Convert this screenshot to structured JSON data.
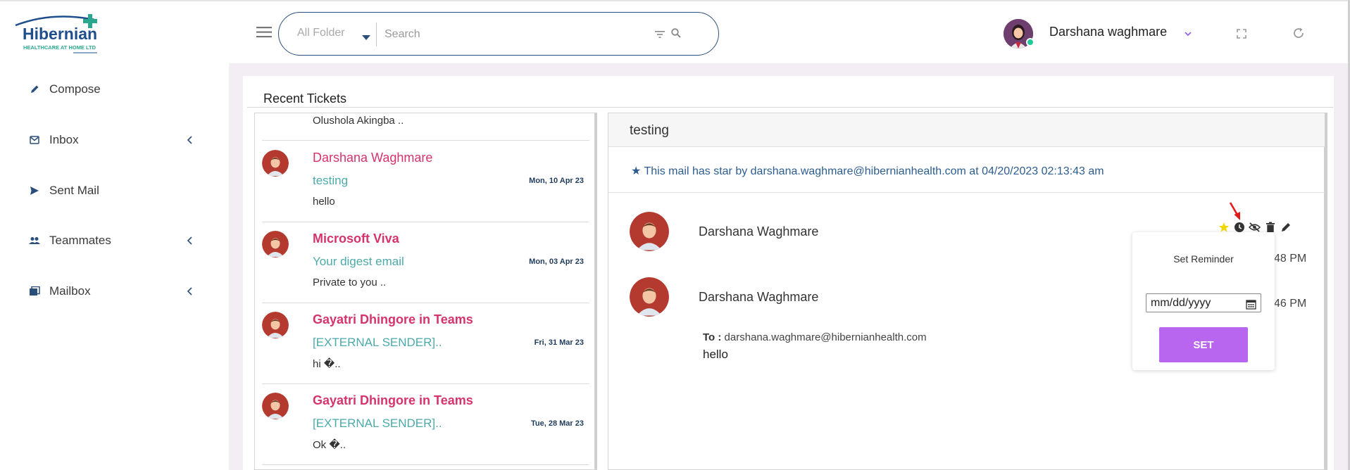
{
  "brand": {
    "name": "Hibernian",
    "tagline": "HEALTHCARE AT HOME LTD"
  },
  "sidebar": {
    "items": [
      {
        "label": "Compose",
        "icon": "pencil-icon",
        "has_submenu": false
      },
      {
        "label": "Inbox",
        "icon": "mail-icon",
        "has_submenu": true
      },
      {
        "label": "Sent Mail",
        "icon": "send-icon",
        "has_submenu": false
      },
      {
        "label": "Teammates",
        "icon": "people-icon",
        "has_submenu": true
      },
      {
        "label": "Mailbox",
        "icon": "folders-icon",
        "has_submenu": true
      }
    ]
  },
  "header": {
    "folder_selected": "All Folder",
    "search_placeholder": "Search",
    "user_name": "Darshana waghmare"
  },
  "recent_tickets": {
    "title": "Recent Tickets",
    "top_partial_preview": "Olushola Akingba ..",
    "tickets": [
      {
        "sender": "Darshana Waghmare",
        "subject": "testing",
        "date": "Mon, 10 Apr 23",
        "preview": "hello",
        "bold": false
      },
      {
        "sender": "Microsoft Viva",
        "subject": "Your digest email",
        "date": "Mon, 03 Apr 23",
        "preview": "Private to you ..",
        "bold": true
      },
      {
        "sender": "Gayatri Dhingore in Teams",
        "subject": "[EXTERNAL SENDER]..",
        "date": "Fri, 31 Mar 23",
        "preview": "hi     �..",
        "bold": true
      },
      {
        "sender": "Gayatri Dhingore in Teams",
        "subject": "[EXTERNAL SENDER]..",
        "date": "Tue, 28 Mar 23",
        "preview": "Ok     �..",
        "bold": true
      }
    ]
  },
  "message_view": {
    "subject": "testing",
    "star_note": "★ This mail has star by darshana.waghmare@hibernianhealth.com at 04/20/2023 02:13:43 am",
    "messages": [
      {
        "sender": "Darshana Waghmare",
        "time_partial": "48 PM"
      },
      {
        "sender": "Darshana Waghmare",
        "time_partial": "46 PM"
      }
    ],
    "to_label": "To :",
    "to_address": "darshana.waghmare@hibernianhealth.com",
    "body": "hello"
  },
  "reminder": {
    "title": "Set Reminder",
    "date_placeholder": "mm/dd/yyyy",
    "set_label": "SET"
  },
  "colors": {
    "accent_pink": "#d6336c",
    "subject_teal": "#4caaa9",
    "set_button": "#b865f0",
    "brand_blue": "#1f4e8c"
  }
}
